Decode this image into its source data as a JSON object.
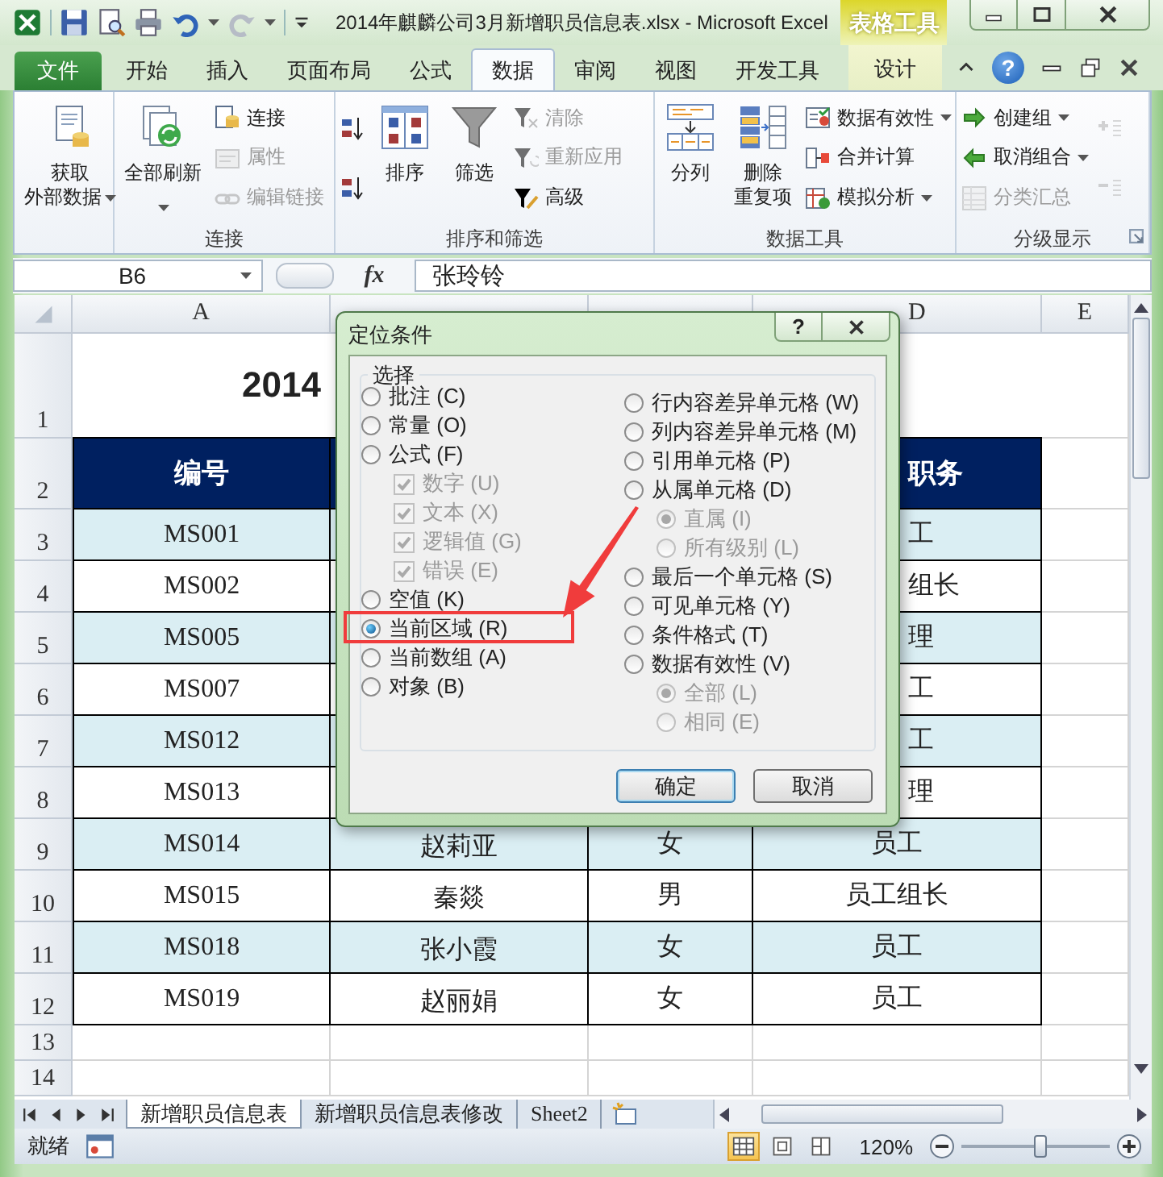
{
  "window": {
    "title": "2014年麒麟公司3月新增职员信息表.xlsx - Microsoft Excel",
    "context_label": "表格工具"
  },
  "ribbon_tabs": [
    {
      "label": "文件",
      "kind": "file",
      "selected": false
    },
    {
      "label": "开始",
      "kind": "normal",
      "selected": false
    },
    {
      "label": "插入",
      "kind": "normal",
      "selected": false
    },
    {
      "label": "页面布局",
      "kind": "normal",
      "selected": false
    },
    {
      "label": "公式",
      "kind": "normal",
      "selected": false
    },
    {
      "label": "数据",
      "kind": "normal",
      "selected": true
    },
    {
      "label": "审阅",
      "kind": "normal",
      "selected": false
    },
    {
      "label": "视图",
      "kind": "normal",
      "selected": false
    },
    {
      "label": "开发工具",
      "kind": "normal",
      "selected": false
    },
    {
      "label": "设计",
      "kind": "context",
      "selected": false
    }
  ],
  "help": "?",
  "ribbon_groups": [
    {
      "columns": [
        {
          "kind": "large",
          "lines": [
            "获取",
            "外部数据"
          ],
          "dropdown": true,
          "disabled": false
        }
      ]
    },
    {
      "label": "连接",
      "columns": [
        {
          "kind": "large",
          "lines": [
            "全部刷新"
          ],
          "dropdown": true,
          "disabled": false
        },
        {
          "kind": "stack",
          "items": [
            {
              "label": "连接",
              "disabled": false
            },
            {
              "label": "属性",
              "disabled": true
            },
            {
              "label": "编辑链接",
              "disabled": true
            }
          ]
        }
      ]
    },
    {
      "label": "排序和筛选",
      "columns": [
        {
          "kind": "stack",
          "items": [
            {
              "disabled": false
            },
            {
              "disabled": false
            }
          ]
        },
        {
          "kind": "large",
          "lines": [
            "排序"
          ],
          "disabled": false
        },
        {
          "kind": "large",
          "lines": [
            "筛选"
          ],
          "disabled": false
        },
        {
          "kind": "stack",
          "items": [
            {
              "label": "清除",
              "disabled": true
            },
            {
              "label": "重新应用",
              "disabled": true
            },
            {
              "label": "高级",
              "disabled": false
            }
          ]
        }
      ]
    },
    {
      "label": "数据工具",
      "columns": [
        {
          "kind": "large",
          "lines": [
            "分列"
          ],
          "disabled": false
        },
        {
          "kind": "large",
          "lines": [
            "删除",
            "重复项"
          ],
          "disabled": false
        },
        {
          "kind": "stack",
          "items": [
            {
              "label": "数据有效性",
              "dropdown": true,
              "disabled": false
            },
            {
              "label": "合并计算",
              "disabled": false
            },
            {
              "label": "模拟分析",
              "dropdown": true,
              "disabled": false
            }
          ]
        }
      ]
    },
    {
      "label": "分级显示",
      "launcher": true,
      "columns": [
        {
          "kind": "stack",
          "items": [
            {
              "label": "创建组",
              "dropdown": true,
              "disabled": false
            },
            {
              "label": "取消组合",
              "dropdown": true,
              "disabled": false
            },
            {
              "label": "分类汇总",
              "disabled": true
            }
          ]
        },
        {
          "kind": "stack",
          "items": [
            {
              "disabled": true
            },
            {
              "disabled": true
            }
          ]
        }
      ]
    }
  ],
  "formula_bar": {
    "name_box": "B6",
    "function_label": "fx",
    "formula": "张玲铃"
  },
  "sheet": {
    "columns": [
      {
        "label": "A"
      },
      {},
      {},
      {
        "label": "D"
      },
      {
        "label": "E"
      }
    ],
    "rows": [
      {
        "number": "1",
        "kind": "title",
        "title": "2014"
      },
      {
        "number": "2",
        "kind": "header",
        "id": "编号",
        "position": "职务"
      },
      {
        "number": "3",
        "kind": "data",
        "shaded": true,
        "id": "MS001",
        "position": "工"
      },
      {
        "number": "4",
        "kind": "data",
        "shaded": false,
        "id": "MS002",
        "position": "组长"
      },
      {
        "number": "5",
        "kind": "data",
        "shaded": true,
        "id": "MS005",
        "position": "理"
      },
      {
        "number": "6",
        "kind": "data",
        "shaded": false,
        "id": "MS007",
        "position": "工"
      },
      {
        "number": "7",
        "kind": "data",
        "shaded": true,
        "id": "MS012",
        "position": "工"
      },
      {
        "number": "8",
        "kind": "data",
        "shaded": false,
        "id": "MS013",
        "position": "理"
      },
      {
        "number": "9",
        "kind": "data",
        "shaded": true,
        "id": "MS014",
        "name": "赵莉亚",
        "gender": "女",
        "position": "员工"
      },
      {
        "number": "10",
        "kind": "data",
        "shaded": false,
        "id": "MS015",
        "name": "秦燚",
        "gender": "男",
        "position": "员工组长"
      },
      {
        "number": "11",
        "kind": "data",
        "shaded": true,
        "id": "MS018",
        "name": "张小霞",
        "gender": "女",
        "position": "员工"
      },
      {
        "number": "12",
        "kind": "data",
        "shaded": false,
        "id": "MS019",
        "name": "赵丽娟",
        "gender": "女",
        "position": "员工"
      },
      {
        "number": "13",
        "kind": "empty"
      },
      {
        "number": "14",
        "kind": "empty"
      }
    ]
  },
  "dialog": {
    "title": "定位条件",
    "help": "?",
    "group_label": "选择",
    "left_options": [
      {
        "kind": "radio",
        "label": "批注 (C)",
        "selected": false,
        "disabled": false
      },
      {
        "kind": "radio",
        "label": "常量 (O)",
        "selected": false,
        "disabled": false
      },
      {
        "kind": "radio",
        "label": "公式 (F)",
        "selected": false,
        "disabled": false,
        "children": [
          {
            "kind": "check",
            "label": "数字 (U)",
            "checked": true,
            "disabled": true
          },
          {
            "kind": "check",
            "label": "文本 (X)",
            "checked": true,
            "disabled": true
          },
          {
            "kind": "check",
            "label": "逻辑值 (G)",
            "checked": true,
            "disabled": true
          },
          {
            "kind": "check",
            "label": "错误 (E)",
            "checked": true,
            "disabled": true
          }
        ]
      },
      {
        "kind": "radio",
        "label": "空值 (K)",
        "selected": false,
        "disabled": false
      },
      {
        "kind": "radio",
        "label": "当前区域 (R)",
        "selected": true,
        "disabled": false
      },
      {
        "kind": "radio",
        "label": "当前数组 (A)",
        "selected": false,
        "disabled": false
      },
      {
        "kind": "radio",
        "label": "对象 (B)",
        "selected": false,
        "disabled": false
      }
    ],
    "right_options": [
      {
        "kind": "radio",
        "label": "行内容差异单元格 (W)",
        "selected": false,
        "disabled": false
      },
      {
        "kind": "radio",
        "label": "列内容差异单元格 (M)",
        "selected": false,
        "disabled": false
      },
      {
        "kind": "radio",
        "label": "引用单元格 (P)",
        "selected": false,
        "disabled": false
      },
      {
        "kind": "radio",
        "label": "从属单元格 (D)",
        "selected": false,
        "disabled": false,
        "children": [
          {
            "kind": "radio",
            "label": "直属 (I)",
            "selected": true,
            "disabled": true
          },
          {
            "kind": "radio",
            "label": "所有级别 (L)",
            "selected": false,
            "disabled": true
          }
        ]
      },
      {
        "kind": "radio",
        "label": "最后一个单元格 (S)",
        "selected": false,
        "disabled": false
      },
      {
        "kind": "radio",
        "label": "可见单元格 (Y)",
        "selected": false,
        "disabled": false
      },
      {
        "kind": "radio",
        "label": "条件格式 (T)",
        "selected": false,
        "disabled": false
      },
      {
        "kind": "radio",
        "label": "数据有效性 (V)",
        "selected": false,
        "disabled": false,
        "children": [
          {
            "kind": "radio",
            "label": "全部 (L)",
            "selected": true,
            "disabled": true
          },
          {
            "kind": "radio",
            "label": "相同 (E)",
            "selected": false,
            "disabled": true
          }
        ]
      }
    ],
    "buttons": [
      {
        "label": "确定",
        "default": true
      },
      {
        "label": "取消",
        "default": false
      }
    ]
  },
  "sheet_tabs": [
    {
      "label": "新增职员信息表",
      "selected": true
    },
    {
      "label": "新增职员信息表修改",
      "selected": false
    },
    {
      "label": "Sheet2",
      "selected": false
    }
  ],
  "status_bar": {
    "status": "就绪",
    "views": [
      {
        "selected": true
      },
      {
        "selected": false
      },
      {
        "selected": false
      }
    ],
    "zoom": {
      "reading": "120%",
      "level": 0.53
    }
  }
}
